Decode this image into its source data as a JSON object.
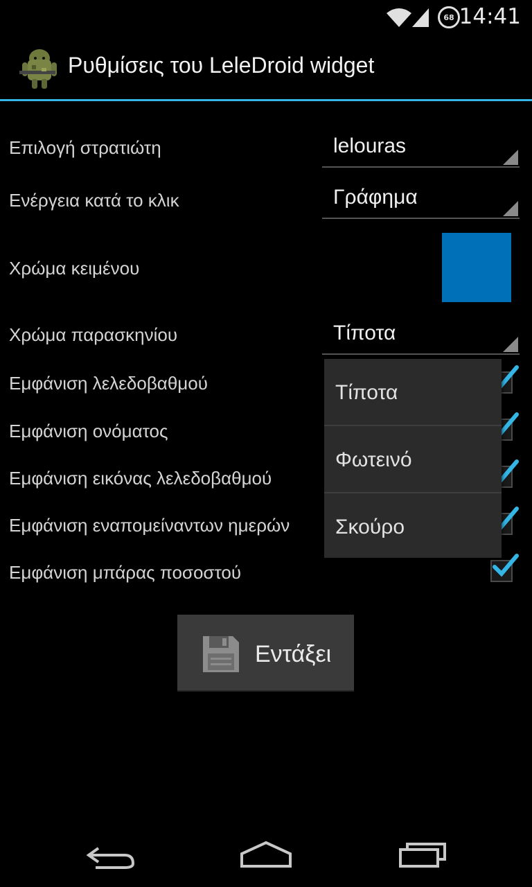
{
  "status_bar": {
    "time": "14:41",
    "battery_level": "68",
    "icons": [
      "wifi-icon",
      "signal-icon",
      "battery-icon"
    ]
  },
  "action_bar": {
    "title": "Ρυθμίσεις του LeleDroid widget",
    "icon": "soldier-android-icon",
    "accent_color": "#33b5e5"
  },
  "settings": {
    "soldier": {
      "label": "Επιλογή στρατιώτη",
      "value": "lelouras"
    },
    "click_action": {
      "label": "Ενέργεια κατά το κλικ",
      "value": "Γράφημα"
    },
    "text_color": {
      "label": "Χρώμα κειμένου",
      "color": "#0070b8"
    },
    "background_color": {
      "label": "Χρώμα παρασκηνίου",
      "value": "Τίποτα"
    },
    "checkboxes": [
      {
        "label": "Εμφάνιση λελεδοβαθμού",
        "checked": true
      },
      {
        "label": "Εμφάνιση ονόματος",
        "checked": true
      },
      {
        "label": "Εμφάνιση εικόνας λελεδοβαθμού",
        "checked": true
      },
      {
        "label": "Εμφάνιση εναπομείναντων ημερών",
        "checked": true
      },
      {
        "label": "Εμφάνιση μπάρας ποσοστού",
        "checked": true
      }
    ]
  },
  "dropdown": {
    "options": [
      "Τίποτα",
      "Φωτεινό",
      "Σκούρο"
    ]
  },
  "ok_button": {
    "label": "Εντάξει",
    "icon": "save-icon"
  },
  "nav_bar": {
    "icons": [
      "back-icon",
      "home-icon",
      "recent-apps-icon"
    ]
  }
}
